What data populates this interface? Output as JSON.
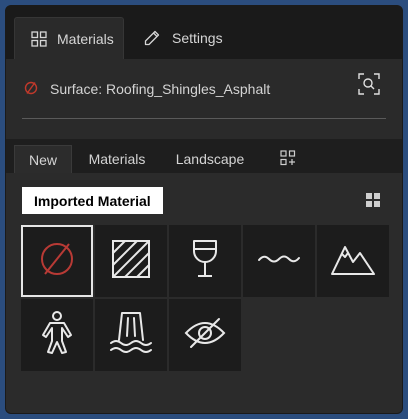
{
  "top_tabs": [
    {
      "label": "Materials",
      "icon": "grid-icon",
      "active": true
    },
    {
      "label": "Settings",
      "icon": "pencil-icon",
      "active": false
    }
  ],
  "surface": {
    "label": "Surface: Roofing_Shingles_Asphalt",
    "status_icon": "no-material-icon",
    "find_icon": "scan-search-icon",
    "status_color": "#c0392b"
  },
  "sub_tabs": [
    {
      "label": "New",
      "active": true
    },
    {
      "label": "Materials",
      "active": false
    },
    {
      "label": "Landscape",
      "active": false
    },
    {
      "label": "",
      "icon": "add-grid-icon",
      "active": false
    }
  ],
  "tooltip": "Imported Material",
  "view_toggle_icon": "thumbnail-grid-icon",
  "tiles": [
    {
      "icon": "no-material-icon",
      "selected": true
    },
    {
      "icon": "hatch-icon",
      "selected": false
    },
    {
      "icon": "glass-icon",
      "selected": false
    },
    {
      "icon": "water-icon",
      "selected": false
    },
    {
      "icon": "mountain-icon",
      "selected": false
    },
    {
      "icon": "person-icon",
      "selected": false
    },
    {
      "icon": "waterfall-icon",
      "selected": false
    },
    {
      "icon": "hidden-icon",
      "selected": false
    }
  ],
  "colors": {
    "accent_red": "#c0392b",
    "panel_bg": "#1e1e1e",
    "content_bg": "#2b2b2b",
    "window_border": "#2b4d7e"
  }
}
